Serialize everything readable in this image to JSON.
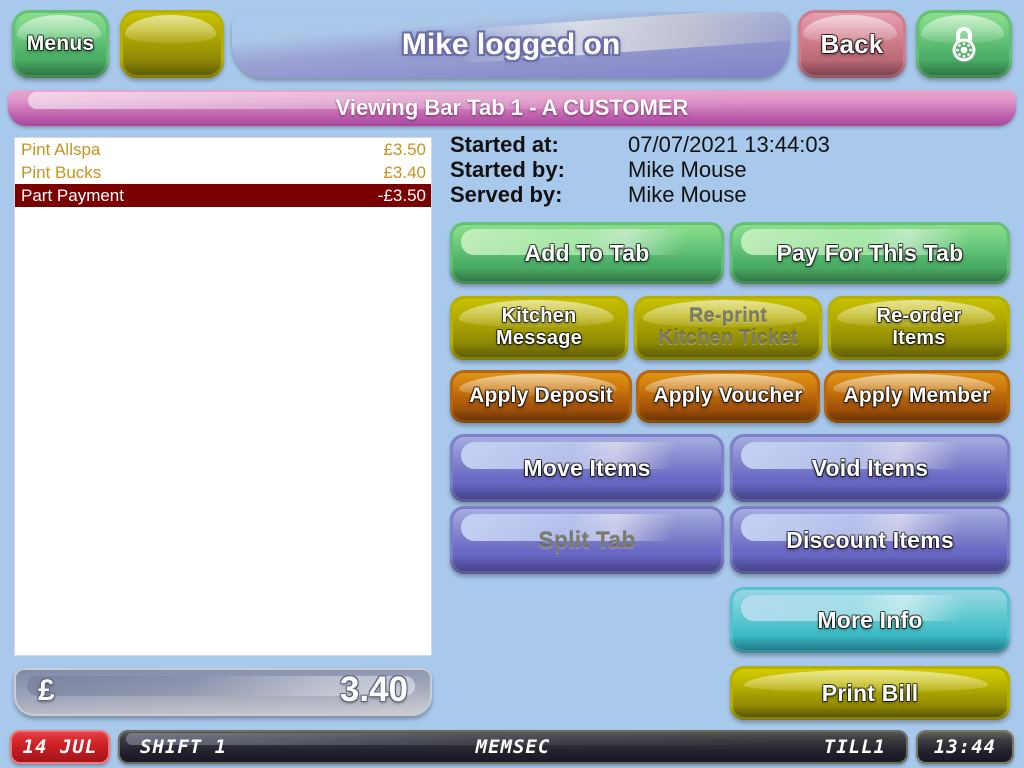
{
  "header": {
    "menus_label": "Menus",
    "menus_disabled": true,
    "blank_label": "",
    "logged_on_text": "Mike logged on",
    "back_label": "Back",
    "lock_icon": "padlock-icon"
  },
  "title_bar": {
    "text": "Viewing Bar Tab 1 - A CUSTOMER"
  },
  "tab_items": [
    {
      "name": "Pint Allspa",
      "amount": "£3.50",
      "selected": false
    },
    {
      "name": "Pint Bucks",
      "amount": "£3.40",
      "selected": false
    },
    {
      "name": "Part Payment",
      "amount": "-£3.50",
      "selected": true
    }
  ],
  "total": {
    "currency_symbol": "£",
    "amount": "3.40"
  },
  "info": {
    "rows": [
      {
        "label": "Started at:",
        "value": "07/07/2021 13:44:03"
      },
      {
        "label": "Started by:",
        "value": "Mike Mouse"
      },
      {
        "label": "Served by:",
        "value": "Mike Mouse"
      }
    ]
  },
  "actions": [
    {
      "id": "add-to-tab",
      "label": "Add To Tab",
      "color": "green",
      "disabled": false
    },
    {
      "id": "pay-for-this-tab",
      "label": "Pay For This Tab",
      "color": "green",
      "disabled": false
    },
    {
      "id": "kitchen-message",
      "label": "Kitchen\nMessage",
      "color": "olive",
      "disabled": false
    },
    {
      "id": "re-print-kitchen-ticket",
      "label": "Re-print\nKitchen Ticket",
      "color": "olive",
      "disabled": true
    },
    {
      "id": "re-order-items",
      "label": "Re-order\nItems",
      "color": "olive",
      "disabled": false
    },
    {
      "id": "apply-deposit",
      "label": "Apply Deposit",
      "color": "orange",
      "disabled": false
    },
    {
      "id": "apply-voucher",
      "label": "Apply Voucher",
      "color": "orange",
      "disabled": false
    },
    {
      "id": "apply-member",
      "label": "Apply Member",
      "color": "orange",
      "disabled": false
    },
    {
      "id": "move-items",
      "label": "Move Items",
      "color": "purple",
      "disabled": false
    },
    {
      "id": "void-items",
      "label": "Void Items",
      "color": "purple",
      "disabled": false
    },
    {
      "id": "split-tab",
      "label": "Split Tab",
      "color": "purple",
      "disabled": true
    },
    {
      "id": "discount-items",
      "label": "Discount Items",
      "color": "purple",
      "disabled": false
    },
    {
      "id": "more-info",
      "label": "More Info",
      "color": "teal",
      "disabled": false
    },
    {
      "id": "print-bill",
      "label": "Print Bill",
      "color": "yellow",
      "disabled": false
    }
  ],
  "footer": {
    "date": "14 JUL",
    "shift": "SHIFT 1",
    "operator": "MEMSEC",
    "till": "TILL1",
    "clock": "13:44"
  },
  "colors": {
    "background": "#a9c9ec",
    "selected_row": "#7a0000",
    "item_text": "#c8941f",
    "title_bar": "#c36ab2"
  }
}
